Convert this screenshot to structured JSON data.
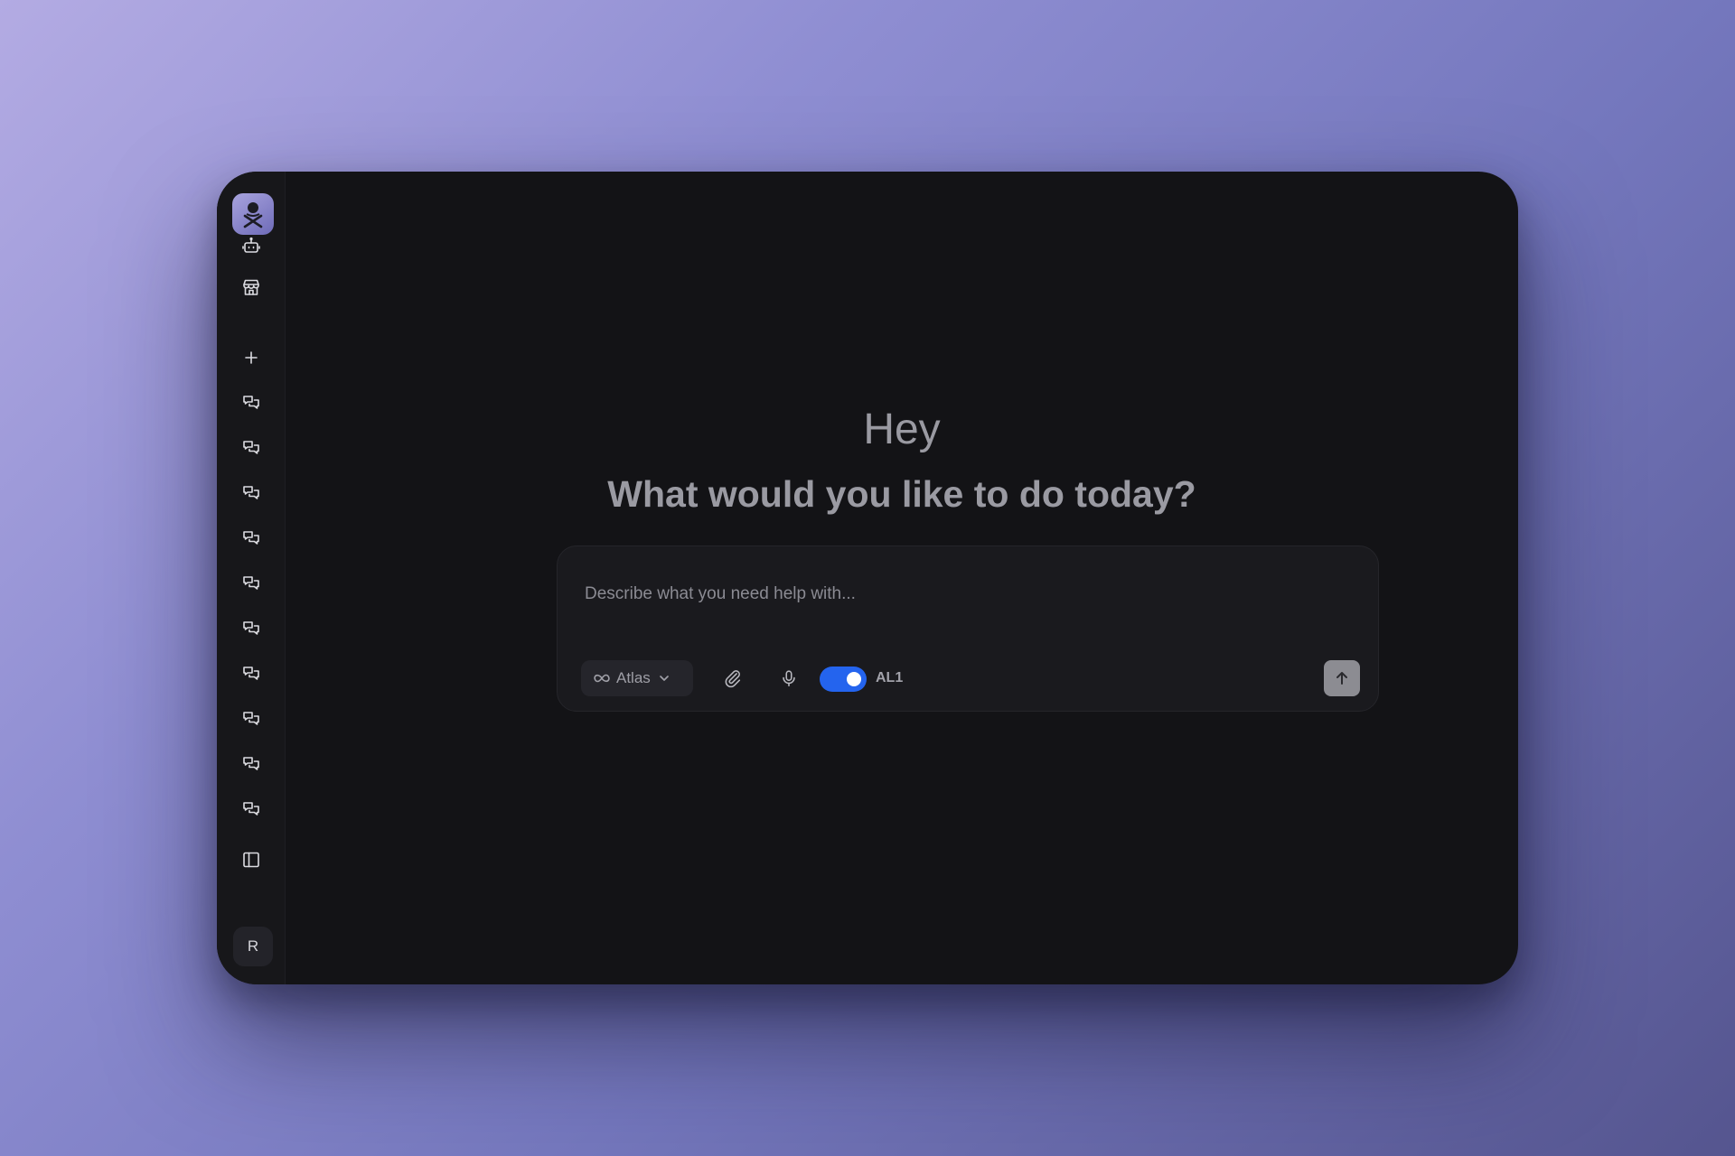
{
  "sidebar": {
    "logo_icon": "spy-agent-logo-icon",
    "top_items": [
      {
        "icon": "robot-icon"
      },
      {
        "icon": "store-icon"
      }
    ],
    "new_chat_icon": "plus-icon",
    "chat_items": [
      {
        "icon": "chat-bubbles-icon"
      },
      {
        "icon": "chat-bubbles-icon"
      },
      {
        "icon": "chat-bubbles-icon"
      },
      {
        "icon": "chat-bubbles-icon"
      },
      {
        "icon": "chat-bubbles-icon"
      },
      {
        "icon": "chat-bubbles-icon"
      },
      {
        "icon": "chat-bubbles-icon"
      },
      {
        "icon": "chat-bubbles-icon"
      },
      {
        "icon": "chat-bubbles-icon"
      },
      {
        "icon": "chat-bubbles-icon"
      }
    ],
    "panel_toggle_icon": "sidebar-panel-icon",
    "avatar_initial": "R"
  },
  "main": {
    "greeting": "Hey",
    "question": "What would you like to do today?"
  },
  "composer": {
    "placeholder": "Describe what you need help with...",
    "value": "",
    "model_label": "Atlas",
    "model_icon": "infinity-icon",
    "attach_icon": "paperclip-icon",
    "mic_icon": "microphone-icon",
    "toggle_on": true,
    "toggle_label": "AL1",
    "send_icon": "arrow-up-icon"
  },
  "colors": {
    "window_bg": "#131316",
    "sidebar_bg": "#17171a",
    "toggle_accent": "#2464ee",
    "send_button": "#8c8c92"
  }
}
